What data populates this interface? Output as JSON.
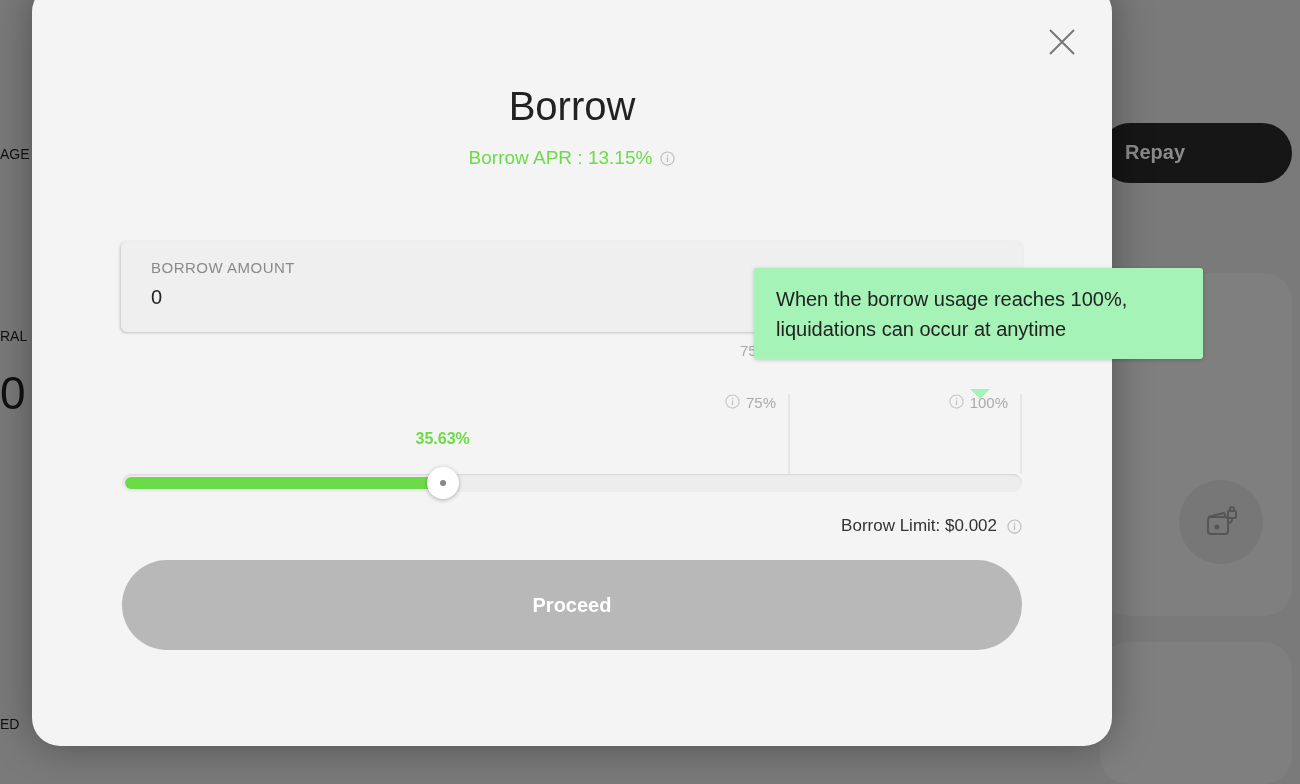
{
  "background": {
    "left_texts": [
      "AGE",
      "RAL",
      "0",
      "ED"
    ],
    "repay_button": "Repay"
  },
  "dialog": {
    "title": "Borrow",
    "apr": "Borrow APR : 13.15%",
    "amount_field": {
      "label": "BORROW AMOUNT",
      "value": "0"
    },
    "hidden_marker": "75",
    "markers": [
      {
        "label": "75%"
      },
      {
        "label": "100%"
      }
    ],
    "usage": {
      "reading": "35.63%",
      "level": 0.3563
    },
    "borrow_limit": "Borrow Limit: $0.002",
    "proceed_button": {
      "label": "Proceed",
      "disabled": true
    },
    "tooltip": "When the borrow usage reaches 100%, liquidations can occur at anytime"
  }
}
